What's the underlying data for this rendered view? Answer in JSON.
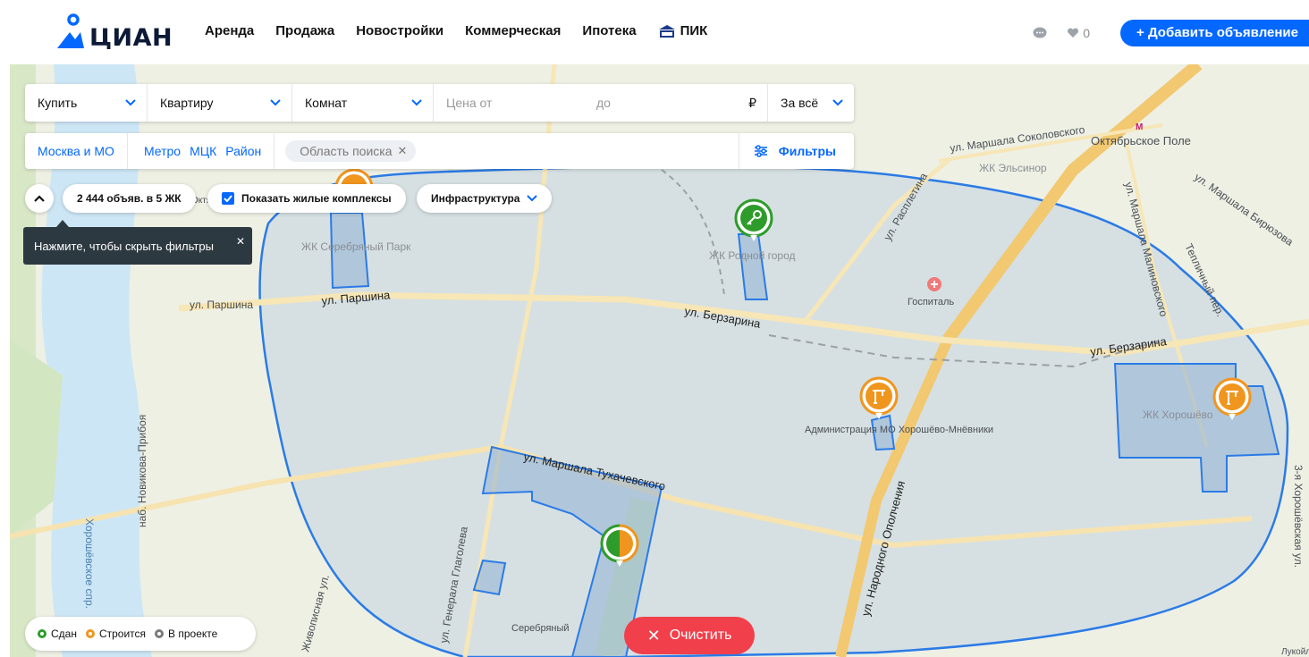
{
  "header": {
    "logo_text": "ЦИАН",
    "nav": [
      "Аренда",
      "Продажа",
      "Новостройки",
      "Коммерческая",
      "Ипотека",
      "ПИК"
    ],
    "pik_badge": "ПИК",
    "favorites_count": "0",
    "add_button": "+ Добавить объявление"
  },
  "filters": {
    "deal_type": "Купить",
    "object_type": "Квартиру",
    "rooms": "Комнат",
    "price_from_placeholder": "Цена от",
    "price_to_placeholder": "до",
    "currency": "₽",
    "price_unit": "За всё",
    "region": "Москва и МО",
    "geo_tabs": [
      "Метро",
      "МЦК",
      "Район"
    ],
    "area_chip": "Область поиска",
    "filters_button": "Фильтры"
  },
  "map_controls": {
    "count": "2 444 объяв. в 5 ЖК",
    "show_complexes": "Показать жилые комплексы",
    "infrastructure": "Инфраструктура",
    "tooltip": "Нажмите, чтобы скрыть фильтры",
    "clear_button": "Очистить"
  },
  "legend": [
    {
      "label": "Сдан",
      "color": "#2e9c2a"
    },
    {
      "label": "Строится",
      "color": "#f0951e"
    },
    {
      "label": "В проекте",
      "color": "#7a7a7a"
    }
  ],
  "map_labels": {
    "oktyabrskoe_pole": "Октябрьское Поле",
    "metro_letter": "М",
    "marshala_sokolovskogo": "ул. Маршала Соколовского",
    "zhk_elsinor": "ЖК Эльсинор",
    "marshala_biryuzova": "ул. Маршала Бирюзова",
    "marshala_malinovskogo": "ул. Маршала Малиновского",
    "teplichny": "Тепличный пер.",
    "raspletina": "ул. Расплетина",
    "gospital": "Госпиталь",
    "berzarina_1": "ул. Берзарина",
    "berzarina_2": "ул. Берзарина",
    "parshina_1": "ул. Паршина",
    "parshina_2": "ул. Паршина",
    "zhk_serebryany_park": "ЖК Серебряный Парк",
    "zhk_rodnoy_gorod": "ЖК Родной город",
    "zhk_khoroshevo": "ЖК Хорошёво",
    "administration": "Администрация МО Хорошёво-Мнёвники",
    "tukhachevskogo": "ул. Маршала Тухачевского",
    "narodnogo_opolcheniya": "ул. Народного Ополчения",
    "novikova_priboya": "наб. Новикова-Прибоя",
    "zhivopisnaya": "Живописная ул.",
    "generala_glagoleva": "ул. Генерала Глаголева",
    "serebryany": "Серебряный",
    "khoroshevskoe": "Хорошёвское спр.",
    "third_khoroshevskaya": "3-я Хорошёвская ул.",
    "lukoil": "Лукойл",
    "oktyabr": "Октябрь"
  }
}
